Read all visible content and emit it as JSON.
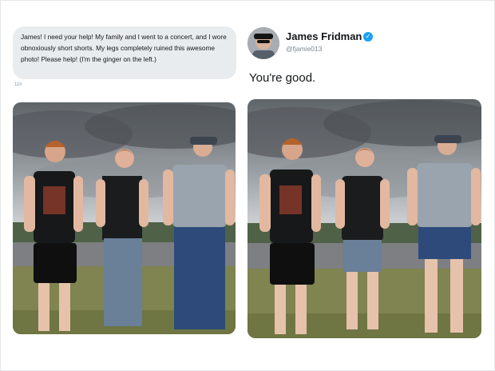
{
  "request": {
    "text": "James! I need your help! My family and I went to a concert, and I wore obnoxiously short shorts. My legs completely ruined this awesome photo! Please help! (I'm the ginger on the left.)",
    "time": "11h"
  },
  "reply": {
    "name": "James Fridman",
    "handle": "@fjamie013",
    "text": "You're good.",
    "verified_icon": "verified-badge-icon",
    "accent": "#1da1f2"
  }
}
